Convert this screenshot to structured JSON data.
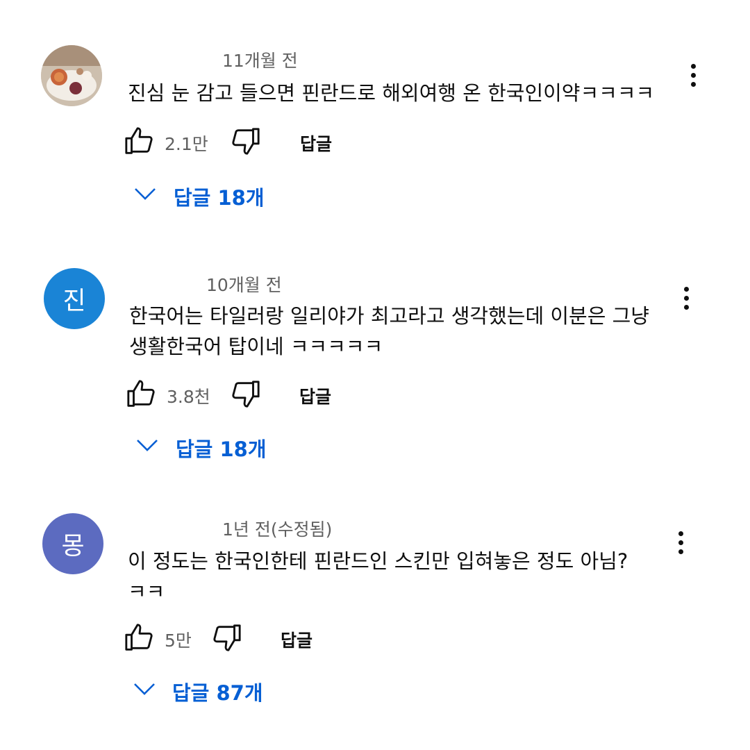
{
  "comments": [
    {
      "avatar_letter": "",
      "avatar_color": "#d9cfc2",
      "time": "11개월 전",
      "text": "진심 눈 감고 들으면 핀란드로 해외여행 온 한국인이약ㅋㅋㅋㅋ",
      "likes": "2.1만",
      "reply_label": "답글",
      "replies_label": "답글 18개"
    },
    {
      "avatar_letter": "진",
      "avatar_color": "#1a84d6",
      "time": "10개월 전",
      "text": "한국어는 타일러랑 일리야가 최고라고 생각했는데 이분은 그냥 생활한국어 탑이네 ㅋㅋㅋㅋㅋ",
      "likes": "3.8천",
      "reply_label": "답글",
      "replies_label": "답글 18개"
    },
    {
      "avatar_letter": "몽",
      "avatar_color": "#5c6bc0",
      "time": "1년 전(수정됨)",
      "text": "이 정도는 한국인한테 핀란드인 스킨만 입혀놓은 정도 아님? ㅋㅋ",
      "likes": "5만",
      "reply_label": "답글",
      "replies_label": "답글 87개"
    }
  ],
  "colors": {
    "link_blue": "#065fd4",
    "meta_gray": "#606060",
    "text": "#0f0f0f"
  },
  "icons": [
    "thumb-up-icon",
    "thumb-down-icon",
    "more-vert-icon",
    "chevron-down-icon"
  ]
}
